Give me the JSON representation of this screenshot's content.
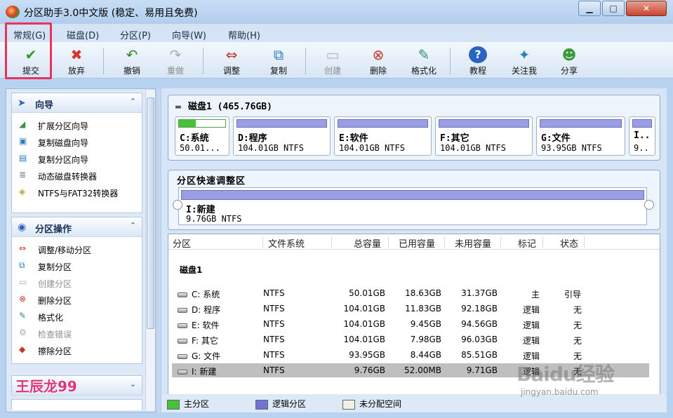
{
  "window": {
    "title": "分区助手3.0中文版 (稳定、易用且免费)",
    "minimize": "▁",
    "maximize": "□",
    "close": "✕"
  },
  "menu": [
    {
      "label": "常规(G)"
    },
    {
      "label": "磁盘(D)"
    },
    {
      "label": "分区(P)"
    },
    {
      "label": "向导(W)"
    },
    {
      "label": "帮助(H)"
    }
  ],
  "toolbar": [
    {
      "label": "提交",
      "icon": "check-icon",
      "enabled": true
    },
    {
      "label": "放弃",
      "icon": "x-icon",
      "enabled": true
    },
    {
      "label": "撤销",
      "icon": "undo-icon",
      "enabled": true
    },
    {
      "label": "重做",
      "icon": "redo-icon",
      "enabled": false
    },
    {
      "label": "调整",
      "icon": "resize-icon",
      "enabled": true
    },
    {
      "label": "复制",
      "icon": "copy-icon",
      "enabled": true
    },
    {
      "label": "创建",
      "icon": "create-icon",
      "enabled": false
    },
    {
      "label": "删除",
      "icon": "delete-icon",
      "enabled": true
    },
    {
      "label": "格式化",
      "icon": "format-icon",
      "enabled": true
    },
    {
      "label": "教程",
      "icon": "help-icon",
      "enabled": true
    },
    {
      "label": "关注我",
      "icon": "follow-icon",
      "enabled": true
    },
    {
      "label": "分享",
      "icon": "share-icon",
      "enabled": true
    }
  ],
  "sidebar": {
    "wizard_title": "向导",
    "wizard_items": [
      {
        "label": "扩展分区向导",
        "icon": "extend-icon",
        "enabled": true
      },
      {
        "label": "复制磁盘向导",
        "icon": "copy-disk-icon",
        "enabled": true
      },
      {
        "label": "复制分区向导",
        "icon": "copy-partition-icon",
        "enabled": true
      },
      {
        "label": "动态磁盘转换器",
        "icon": "dynamic-disk-icon",
        "enabled": true
      },
      {
        "label": "NTFS与FAT32转换器",
        "icon": "ntfs-fat32-icon",
        "enabled": true
      }
    ],
    "ops_title": "分区操作",
    "ops_items": [
      {
        "label": "调整/移动分区",
        "icon": "resize-move-icon",
        "enabled": true
      },
      {
        "label": "复制分区",
        "icon": "copy-icon",
        "enabled": true
      },
      {
        "label": "创建分区",
        "icon": "create-icon",
        "enabled": false
      },
      {
        "label": "删除分区",
        "icon": "delete-icon",
        "enabled": true
      },
      {
        "label": "格式化",
        "icon": "format-icon",
        "enabled": true
      },
      {
        "label": "检查错误",
        "icon": "check-error-icon",
        "enabled": false
      },
      {
        "label": "擦除分区",
        "icon": "wipe-icon",
        "enabled": true
      }
    ],
    "author_watermark": "王辰龙99"
  },
  "disk": {
    "title": "磁盘1 (465.76GB)",
    "partitions": [
      {
        "name": "C:系统",
        "info": "50.01...",
        "type": "primary",
        "used_fraction": 0.37
      },
      {
        "name": "D:程序",
        "info": "104.01GB NTFS",
        "type": "logical"
      },
      {
        "name": "E:软件",
        "info": "104.01GB NTFS",
        "type": "logical"
      },
      {
        "name": "F:其它",
        "info": "104.01GB NTFS",
        "type": "logical"
      },
      {
        "name": "G:文件",
        "info": "93.95GB NTFS",
        "type": "logical"
      },
      {
        "name": "I..",
        "info": "9..",
        "type": "logical"
      }
    ]
  },
  "quick": {
    "title": "分区快速调整区",
    "partition_name": "I:新建",
    "partition_info": "9.76GB NTFS"
  },
  "table": {
    "headers": [
      "分区",
      "文件系统",
      "总容量",
      "已用容量",
      "未用容量",
      "标记",
      "状态"
    ],
    "group": "磁盘1",
    "rows": [
      {
        "name": "C: 系统",
        "fs": "NTFS",
        "total": "50.01GB",
        "used": "18.63GB",
        "free": "31.37GB",
        "flag": "主",
        "status": "引导"
      },
      {
        "name": "D: 程序",
        "fs": "NTFS",
        "total": "104.01GB",
        "used": "11.83GB",
        "free": "92.18GB",
        "flag": "逻辑",
        "status": "无"
      },
      {
        "name": "E: 软件",
        "fs": "NTFS",
        "total": "104.01GB",
        "used": "9.45GB",
        "free": "94.56GB",
        "flag": "逻辑",
        "status": "无"
      },
      {
        "name": "F: 其它",
        "fs": "NTFS",
        "total": "104.01GB",
        "used": "7.98GB",
        "free": "96.03GB",
        "flag": "逻辑",
        "status": "无"
      },
      {
        "name": "G: 文件",
        "fs": "NTFS",
        "total": "93.95GB",
        "used": "8.44GB",
        "free": "85.51GB",
        "flag": "逻辑",
        "status": "无"
      },
      {
        "name": "I: 新建",
        "fs": "NTFS",
        "total": "9.76GB",
        "used": "52.00MB",
        "free": "9.71GB",
        "flag": "逻辑",
        "status": "无",
        "selected": true
      }
    ]
  },
  "legend": [
    {
      "label": "主分区",
      "color": "#46c13a"
    },
    {
      "label": "逻辑分区",
      "color": "#6f73d8"
    },
    {
      "label": "未分配空间",
      "color": "#f2efe6"
    }
  ],
  "watermark": {
    "brand": "Baidu经验",
    "url": "jingyan.baidu.com"
  },
  "colors": {
    "primary_partition": "#46c13a",
    "logical_partition": "#9a9ee6",
    "highlight_box": "#e8335a"
  }
}
